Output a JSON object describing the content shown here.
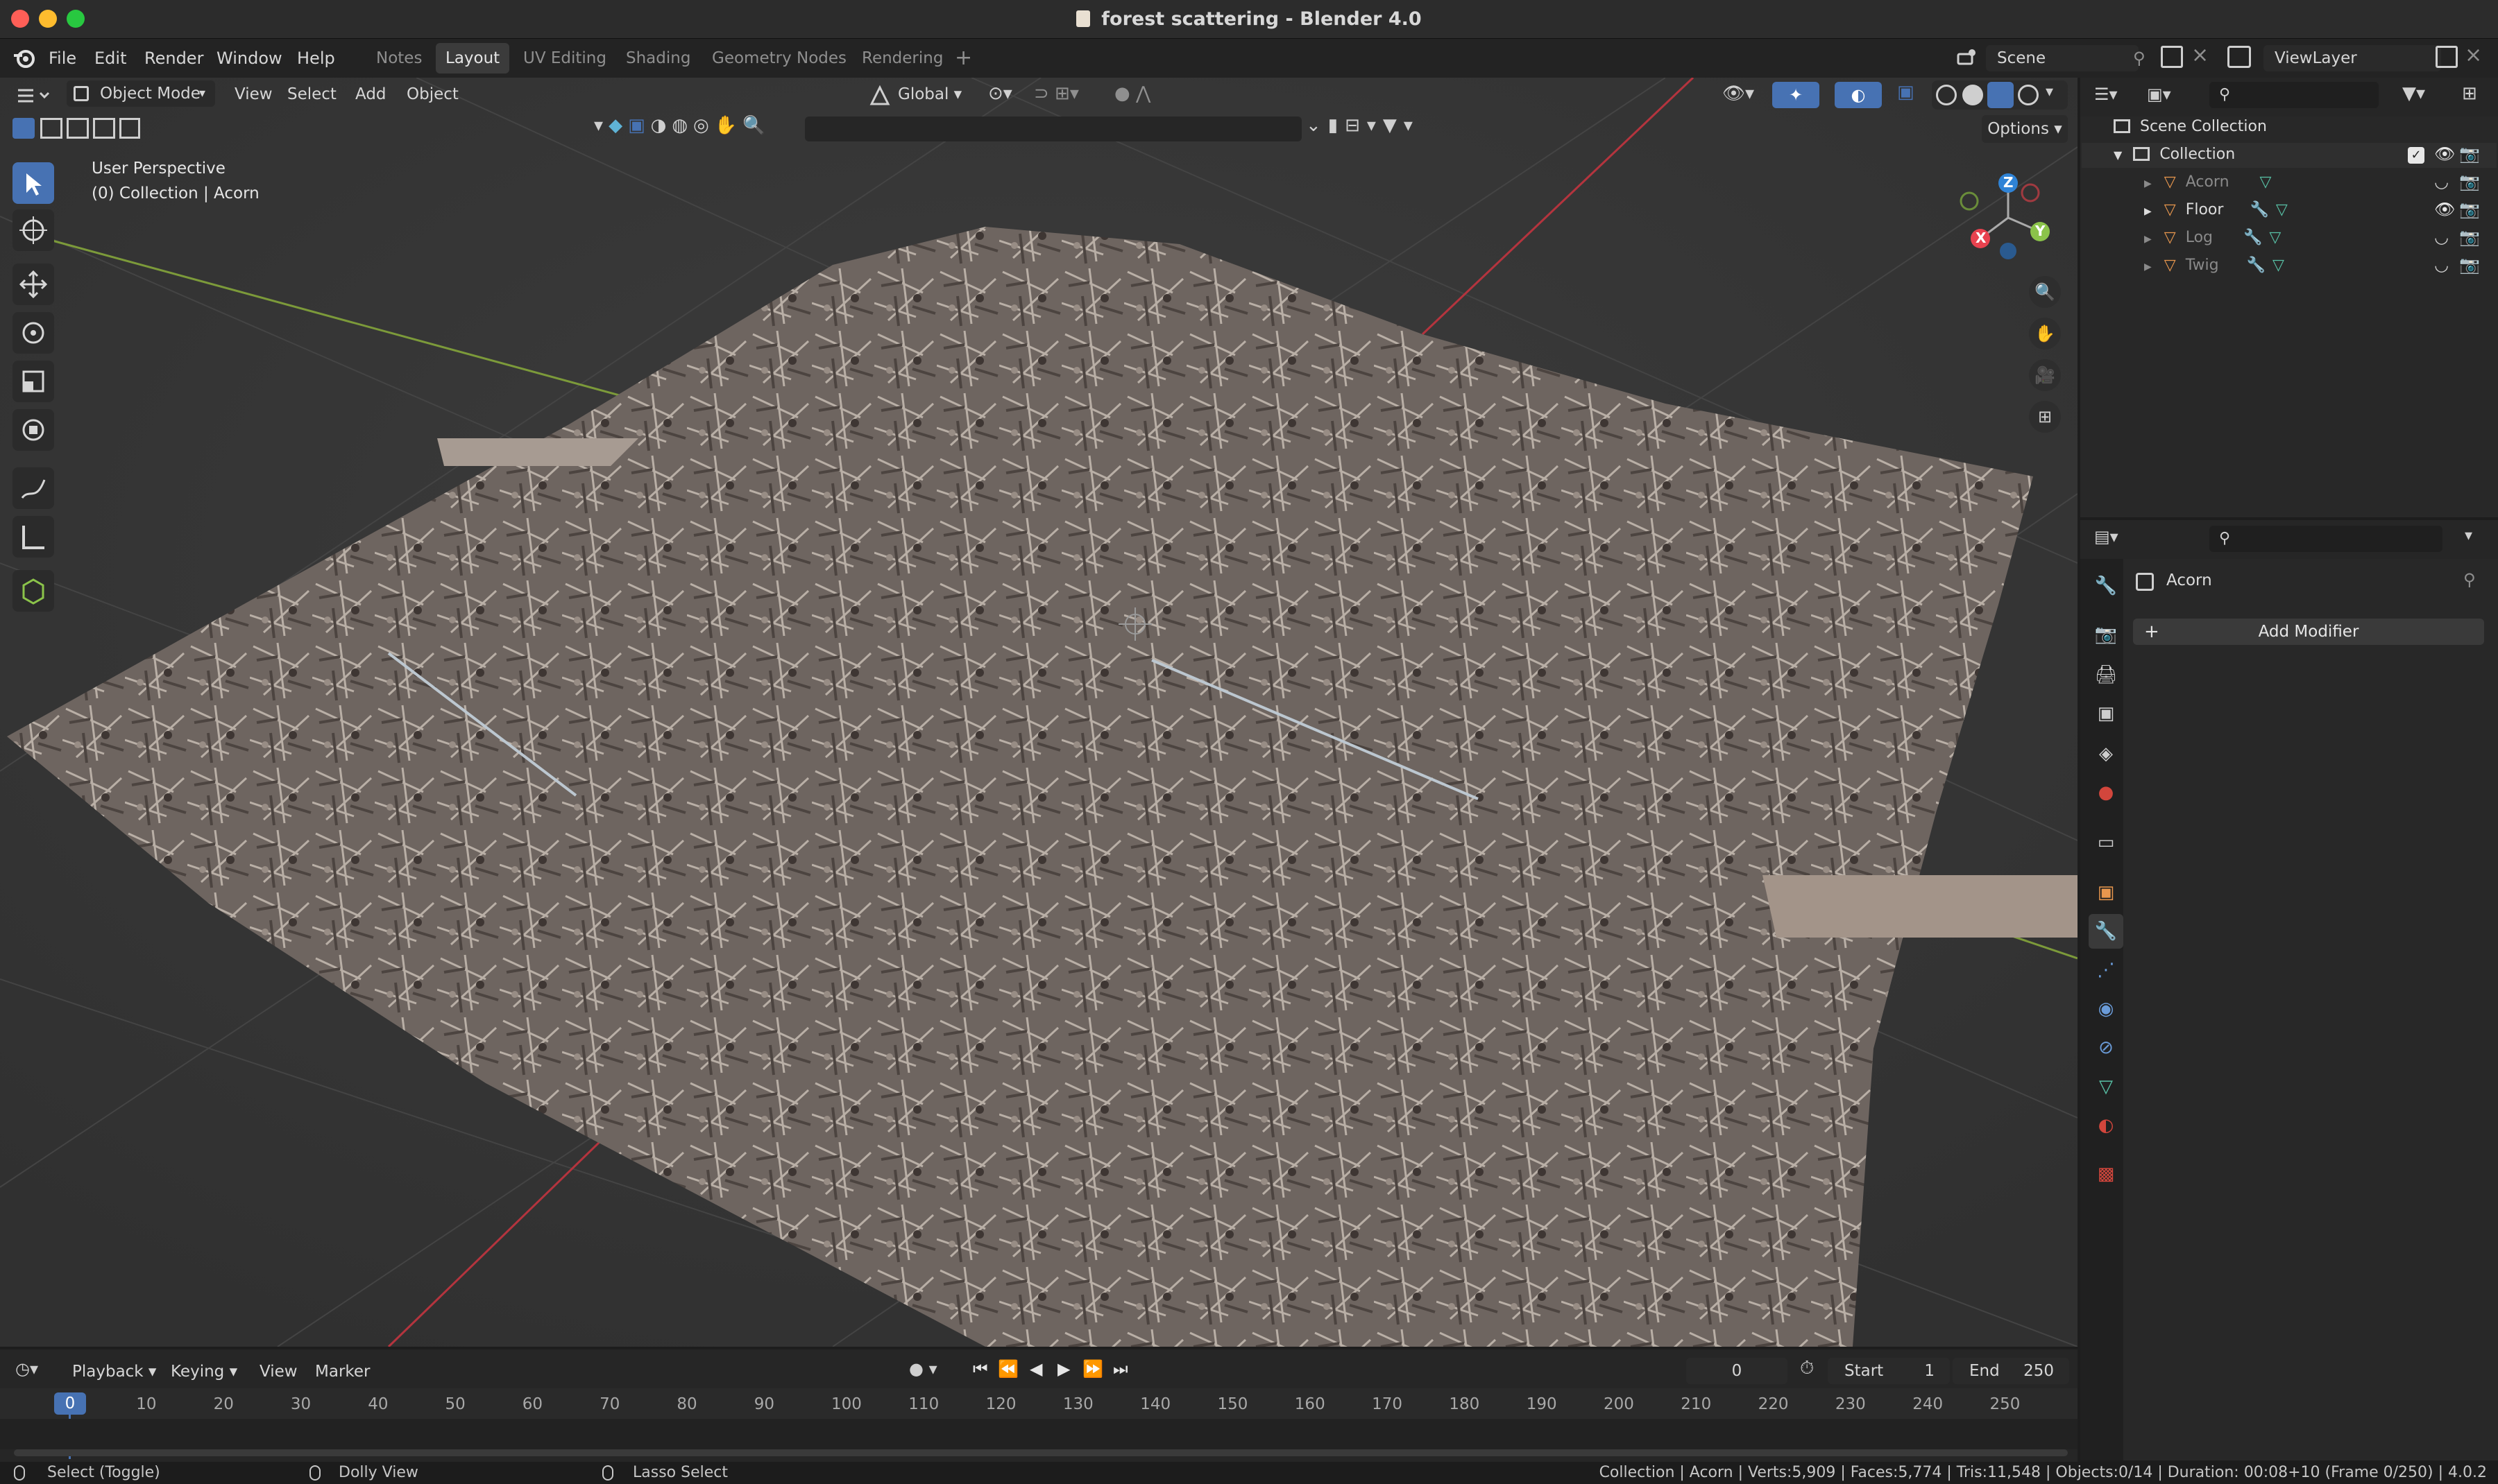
{
  "window": {
    "title": "forest scattering - Blender 4.0"
  },
  "menu": {
    "items": [
      "File",
      "Edit",
      "Render",
      "Window",
      "Help"
    ]
  },
  "workspaces": {
    "tabs": [
      "Notes",
      "Layout",
      "UV Editing",
      "Shading",
      "Geometry Nodes",
      "Rendering"
    ],
    "active": "Layout"
  },
  "scene": {
    "label": "Scene",
    "view_layer": "ViewLayer"
  },
  "viewport_header": {
    "mode": "Object Mode",
    "menus": [
      "View",
      "Select",
      "Add",
      "Object"
    ],
    "orientation": "Global",
    "options": "Options"
  },
  "viewport": {
    "perspective": "User Perspective",
    "context": "(0) Collection | Acorn"
  },
  "gizmo": {
    "x": "X",
    "y": "Y",
    "z": "Z"
  },
  "outliner": {
    "root": "Scene Collection",
    "collection": "Collection",
    "objects": [
      {
        "name": "Acorn",
        "dim": true
      },
      {
        "name": "Floor",
        "dim": false
      },
      {
        "name": "Log",
        "dim": true
      },
      {
        "name": "Twig",
        "dim": true
      }
    ]
  },
  "properties": {
    "object": "Acorn",
    "add_modifier": "Add Modifier"
  },
  "timeline": {
    "menus": [
      "Playback",
      "Keying",
      "View",
      "Marker"
    ],
    "current_frame": "0",
    "start_label": "Start",
    "start": "1",
    "end_label": "End",
    "end": "250",
    "ticks": [
      "0",
      "10",
      "20",
      "30",
      "40",
      "50",
      "60",
      "70",
      "80",
      "90",
      "100",
      "110",
      "120",
      "130",
      "140",
      "150",
      "160",
      "170",
      "180",
      "190",
      "200",
      "210",
      "220",
      "230",
      "240",
      "250"
    ]
  },
  "statusbar": {
    "left": [
      "Select (Toggle)",
      "Dolly View",
      "Lasso Select"
    ],
    "right": "Collection | Acorn | Verts:5,909 | Faces:5,774 | Tris:11,548 | Objects:0/14 | Duration: 00:08+10 (Frame 0/250) | 4.0.2"
  },
  "colors": {
    "accent": "#4772b3",
    "x_axis": "#e8424f",
    "y_axis": "#8bc34a",
    "z_axis": "#2f83d6",
    "mesh": "#7a6f6a"
  }
}
